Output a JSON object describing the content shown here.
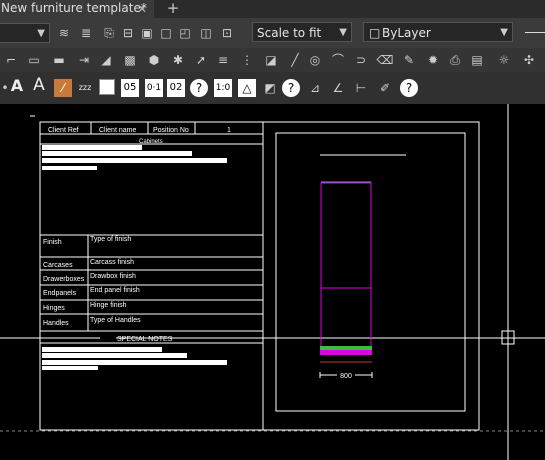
{
  "tab": {
    "title": "New furniture template*",
    "close": "✕",
    "add": "+"
  },
  "toolbar1": {
    "scale": "Scale to fit",
    "layer": "ByLayer"
  },
  "toolbar3": {
    "text_a1": "A",
    "text_a2": "A",
    "zz": "zzz",
    "num1": "05",
    "num2": "0·1",
    "num3": "02",
    "num4": "1:0"
  },
  "table": {
    "header": [
      "Client Ref",
      "Client name",
      "Position No",
      "1"
    ],
    "section_title": "Cabinets",
    "rows": [
      {
        "label": "Finish",
        "value": "Type of finish"
      },
      {
        "label": "Carcases",
        "value": "Carcass finish"
      },
      {
        "label": "Drawerboxes",
        "value": "Drawbox finish"
      },
      {
        "label": "Endpanels",
        "value": "End panel finish"
      },
      {
        "label": "Hinges",
        "value": "Hinge finish"
      },
      {
        "label": "Handles",
        "value": "Type of Handles"
      }
    ],
    "notes_title": "SPECIAL NOTES"
  },
  "drawing": {
    "dim_label": "800"
  },
  "colors": {
    "accent_magenta": "#e000e0",
    "accent_green": "#3dbd3d",
    "line": "#ffffff"
  }
}
